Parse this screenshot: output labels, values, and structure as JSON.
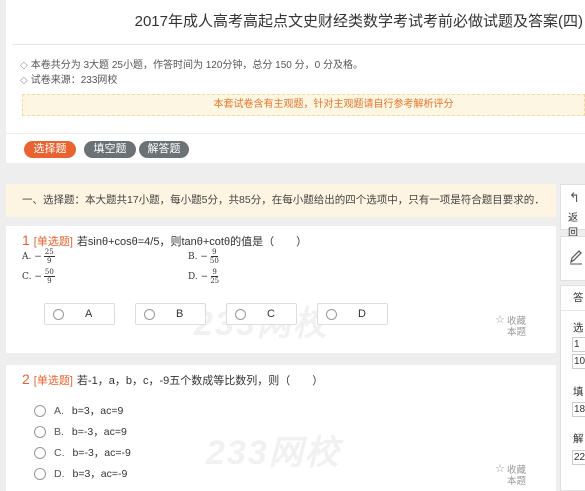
{
  "header": {
    "title": "2017年成人高考高起点文史财经类数学考试考前必做试题及答案(四)",
    "info_line": "本卷共分为 3大题 25小题，作答时间为 120分钟，总分 150 分，0 分及格。",
    "source_line": "试卷来源：233网校",
    "notice": "本套试卷含有主观题，针对主观题请自行参考解析评分"
  },
  "tabs": [
    {
      "label": "选择题",
      "active": true
    },
    {
      "label": "填空题",
      "active": false
    },
    {
      "label": "解答题",
      "active": false
    }
  ],
  "section_banner": "一、选择题：本大题共17小题，每小题5分，共85分，在每小题给出的四个选项中，只有一项是符合题目要求的．",
  "questions": [
    {
      "number": "1",
      "type": "[单选题]",
      "text": "若sinθ+cosθ=4/5，则tanθ+cotθ的值是（　　）",
      "math_options": [
        {
          "letter": "A.",
          "sign": "−",
          "num": "25",
          "den": "9"
        },
        {
          "letter": "B.",
          "sign": "−",
          "num": "9",
          "den": "50"
        },
        {
          "letter": "C.",
          "sign": "−",
          "num": "50",
          "den": "9"
        },
        {
          "letter": "D.",
          "sign": "−",
          "num": "9",
          "den": "25"
        }
      ],
      "choices": [
        "A",
        "B",
        "C",
        "D"
      ],
      "favorite": [
        "收藏",
        "本题"
      ]
    },
    {
      "number": "2",
      "type": "[单选题]",
      "text": "若-1，a，b，c，-9五个数成等比数列，则（　　）",
      "options": [
        {
          "letter": "A.",
          "text": "b=3，ac=9"
        },
        {
          "letter": "B.",
          "text": "b=-3，ac=9"
        },
        {
          "letter": "C.",
          "text": "b=-3，ac=-9"
        },
        {
          "letter": "D.",
          "text": "b=3，ac=-9"
        }
      ],
      "favorite": [
        "收藏",
        "本题"
      ]
    }
  ],
  "watermark": "233网校",
  "right_panel": {
    "back_label": "返回",
    "sheet_header": "答",
    "sections": [
      {
        "label": "选",
        "cells": [
          "1",
          "10"
        ]
      },
      {
        "label": "填",
        "cells": [
          "18"
        ]
      },
      {
        "label": "解",
        "cells": [
          "22"
        ]
      }
    ]
  },
  "colors": {
    "accent": "#e8632f",
    "tab_inactive": "#6b7276",
    "notice_text": "#e8752b",
    "banner_bg": "#fdf4e2"
  }
}
